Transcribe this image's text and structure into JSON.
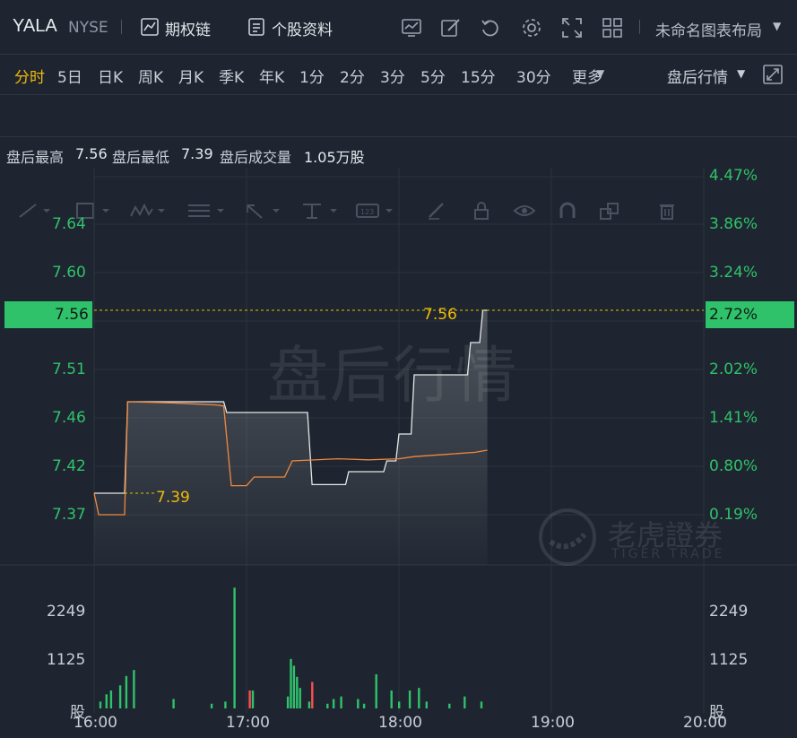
{
  "header": {
    "ticker": "YALA",
    "exchange": "NYSE",
    "options_label": "期权链",
    "profile_label": "个股资料",
    "layout_label": "未命名图表布局"
  },
  "periods": {
    "items": [
      "分时",
      "5日",
      "日K",
      "周K",
      "月K",
      "季K",
      "年K",
      "1分",
      "2分",
      "3分",
      "5分",
      "15分",
      "30分",
      "更多"
    ],
    "active": "分时",
    "session_label": "盘后行情"
  },
  "summary": {
    "high_label": "盘后最高",
    "high_value": "7.56",
    "low_label": "盘后最低",
    "low_value": "7.39",
    "volume_label": "盘后成交量",
    "volume_value": "1.05万股"
  },
  "watermark": {
    "session_text": "盘后行情",
    "brand_cn": "老虎證券",
    "brand_en": "TIGER TRADE"
  },
  "colors": {
    "up": "#2fc26a",
    "down": "#ff4d4f",
    "accent": "#f0b90b",
    "avg_line": "#f0883e",
    "price_line": "#e6e6e6"
  },
  "chart_data": {
    "type": "line",
    "price_ticks_left": [
      "7.64",
      "7.60",
      "7.56",
      "7.51",
      "7.46",
      "7.42",
      "7.37"
    ],
    "pct_ticks_right": [
      "4.47%",
      "3.86%",
      "3.24%",
      "2.72%",
      "2.02%",
      "1.41%",
      "0.80%",
      "0.19%"
    ],
    "current_price": "7.56",
    "current_pct": "2.72%",
    "low_marker": "7.39",
    "high_marker": "7.56",
    "ylim": [
      7.37,
      7.67
    ],
    "x_ticks": [
      "16:00",
      "17:00",
      "18:00",
      "19:00",
      "20:00"
    ],
    "volume_ticks": [
      "2249",
      "1125"
    ],
    "volume_unit_label": "股",
    "price_series": {
      "name": "price",
      "points": [
        [
          0,
          7.39
        ],
        [
          0.2,
          7.39
        ],
        [
          0.22,
          7.475
        ],
        [
          0.85,
          7.475
        ],
        [
          0.87,
          7.465
        ],
        [
          1.4,
          7.465
        ],
        [
          1.43,
          7.398
        ],
        [
          1.65,
          7.398
        ],
        [
          1.67,
          7.41
        ],
        [
          1.9,
          7.41
        ],
        [
          1.92,
          7.42
        ],
        [
          1.98,
          7.42
        ],
        [
          2.0,
          7.445
        ],
        [
          2.08,
          7.445
        ],
        [
          2.1,
          7.5
        ],
        [
          2.45,
          7.5
        ],
        [
          2.47,
          7.53
        ],
        [
          2.53,
          7.53
        ],
        [
          2.55,
          7.56
        ],
        [
          2.58,
          7.56
        ]
      ]
    },
    "avg_series": {
      "name": "avg",
      "points": [
        [
          0,
          7.39
        ],
        [
          0.03,
          7.37
        ],
        [
          0.2,
          7.37
        ],
        [
          0.22,
          7.475
        ],
        [
          0.5,
          7.474
        ],
        [
          0.8,
          7.472
        ],
        [
          0.85,
          7.471
        ],
        [
          0.9,
          7.397
        ],
        [
          1.0,
          7.397
        ],
        [
          1.05,
          7.405
        ],
        [
          1.25,
          7.405
        ],
        [
          1.3,
          7.42
        ],
        [
          1.6,
          7.422
        ],
        [
          1.8,
          7.421
        ],
        [
          2.0,
          7.422
        ],
        [
          2.1,
          7.424
        ],
        [
          2.3,
          7.426
        ],
        [
          2.5,
          7.428
        ],
        [
          2.58,
          7.43
        ]
      ]
    },
    "volume": [
      {
        "t": 0.04,
        "v": 160,
        "c": "up"
      },
      {
        "t": 0.08,
        "v": 330,
        "c": "up"
      },
      {
        "t": 0.11,
        "v": 420,
        "c": "up"
      },
      {
        "t": 0.17,
        "v": 540,
        "c": "up"
      },
      {
        "t": 0.21,
        "v": 760,
        "c": "up"
      },
      {
        "t": 0.26,
        "v": 900,
        "c": "up"
      },
      {
        "t": 0.52,
        "v": 220,
        "c": "up"
      },
      {
        "t": 0.77,
        "v": 110,
        "c": "up"
      },
      {
        "t": 0.86,
        "v": 160,
        "c": "up"
      },
      {
        "t": 0.92,
        "v": 2830,
        "c": "up"
      },
      {
        "t": 1.02,
        "v": 420,
        "c": "down"
      },
      {
        "t": 1.04,
        "v": 420,
        "c": "up"
      },
      {
        "t": 1.27,
        "v": 280,
        "c": "up"
      },
      {
        "t": 1.29,
        "v": 1160,
        "c": "up"
      },
      {
        "t": 1.31,
        "v": 1000,
        "c": "up"
      },
      {
        "t": 1.33,
        "v": 740,
        "c": "up"
      },
      {
        "t": 1.35,
        "v": 480,
        "c": "up"
      },
      {
        "t": 1.41,
        "v": 160,
        "c": "up"
      },
      {
        "t": 1.43,
        "v": 620,
        "c": "down"
      },
      {
        "t": 1.53,
        "v": 110,
        "c": "up"
      },
      {
        "t": 1.57,
        "v": 220,
        "c": "up"
      },
      {
        "t": 1.62,
        "v": 280,
        "c": "up"
      },
      {
        "t": 1.73,
        "v": 220,
        "c": "up"
      },
      {
        "t": 1.77,
        "v": 110,
        "c": "up"
      },
      {
        "t": 1.85,
        "v": 800,
        "c": "up"
      },
      {
        "t": 1.95,
        "v": 420,
        "c": "up"
      },
      {
        "t": 2.0,
        "v": 160,
        "c": "up"
      },
      {
        "t": 2.07,
        "v": 420,
        "c": "up"
      },
      {
        "t": 2.13,
        "v": 480,
        "c": "up"
      },
      {
        "t": 2.18,
        "v": 160,
        "c": "up"
      },
      {
        "t": 2.33,
        "v": 110,
        "c": "up"
      },
      {
        "t": 2.43,
        "v": 280,
        "c": "up"
      },
      {
        "t": 2.54,
        "v": 160,
        "c": "up"
      }
    ],
    "volume_max": 2900
  }
}
